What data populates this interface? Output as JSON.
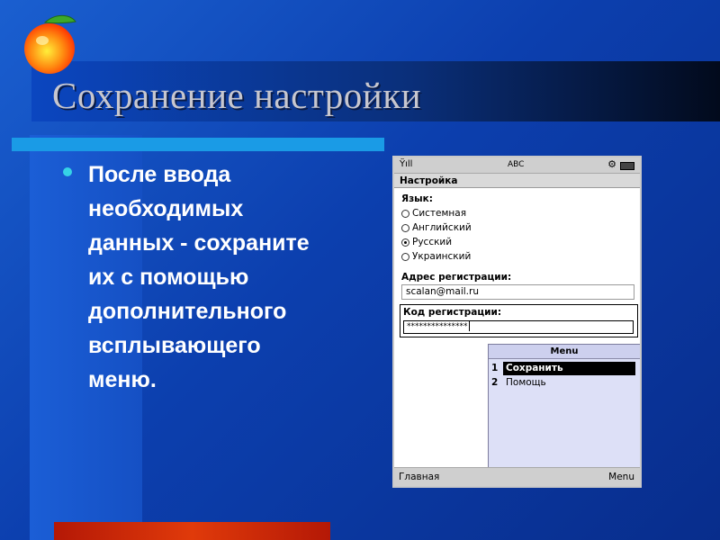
{
  "slide": {
    "title": "Сохранение настройки",
    "bullet_text": "После ввода\nнеобходимых\nданных - сохраните\n их с помощью\nдополнительного\nвсплывающего\nменю."
  },
  "phone": {
    "status": {
      "signal": "Ÿıll",
      "mode": "ABC",
      "settings_icon": "gear-icon",
      "battery_icon": "battery-icon"
    },
    "screen_title": "Настройка",
    "language_label": "Язык:",
    "languages": [
      {
        "label": "Системная",
        "checked": false
      },
      {
        "label": "Английский",
        "checked": false
      },
      {
        "label": "Русский",
        "checked": true
      },
      {
        "label": "Украинский",
        "checked": false
      }
    ],
    "address_label": "Адрес регистрации:",
    "address_value": "scalan@mail.ru",
    "code_label": "Код регистрации:",
    "code_value": "***************",
    "menu": {
      "title": "Menu",
      "items": [
        {
          "number": "1",
          "label": "Сохранить",
          "selected": true
        },
        {
          "number": "2",
          "label": "Помощь",
          "selected": false
        }
      ]
    },
    "softkeys": {
      "left": "Главная",
      "right": "Menu"
    }
  },
  "colors": {
    "background": "#0c3fae",
    "accent_cyan": "#1a9be6",
    "accent_red": "#e03a0a",
    "bullet": "#36d3e6"
  }
}
